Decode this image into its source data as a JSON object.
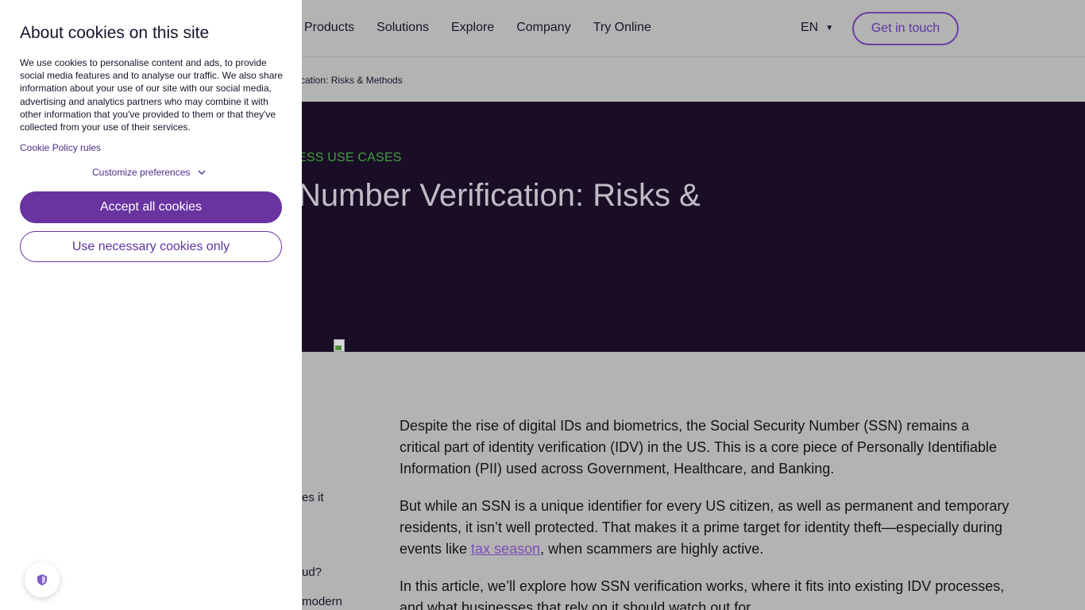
{
  "nav": {
    "items": [
      "Products",
      "Solutions",
      "Explore",
      "Company",
      "Try Online"
    ],
    "language": "EN",
    "cta": "Get in touch"
  },
  "breadcrumb": "fication: Risks & Methods",
  "hero": {
    "eyebrow": "ESS USE CASES",
    "title": "Number Verification: Risks &"
  },
  "article": {
    "p1": "Despite the rise of digital IDs and biometrics, the Social Security Number (SSN) remains a critical part of identity verification (IDV) in the US. This is a core piece of Personally Identifiable Information (PII) used across Government, Healthcare, and Banking.",
    "p2_before": "But while an SSN is a unique identifier for every US citizen, as well as permanent and temporary residents, it isn’t well protected. That makes it a prime target for identity theft—especially during events like ",
    "p2_link": "tax season",
    "p2_after": ", when scammers are highly active.",
    "p3": "In this article, we’ll explore how SSN verification works, where it fits into existing IDV processes, and what businesses that rely on it should watch out for."
  },
  "toc_fragments": [
    "es it",
    "ud?",
    "modern"
  ],
  "cookie": {
    "title": "About cookies on this site",
    "text": "We use cookies to personalise content and ads, to provide social media features and to analyse our traffic. We also share information about your use of our site with our social media, advertising and analytics partners who may combine it with other information that you've provided to them or that they've collected from your use of their services.",
    "policy_link": "Cookie Policy rules",
    "customize": "Customize preferences",
    "accept": "Accept all cookies",
    "necessary": "Use necessary cookies only"
  },
  "icons": {
    "lang_caret": "caret-down-icon",
    "customize_chevron": "chevron-down-icon",
    "badge": "shield-icon",
    "hero_image": "broken-image-icon"
  },
  "colors": {
    "brand_purple": "#6933a0",
    "hero_bg": "#1a0e26",
    "eyebrow_green": "#3fa13a",
    "overlay_gray": "#b3b3b3"
  }
}
